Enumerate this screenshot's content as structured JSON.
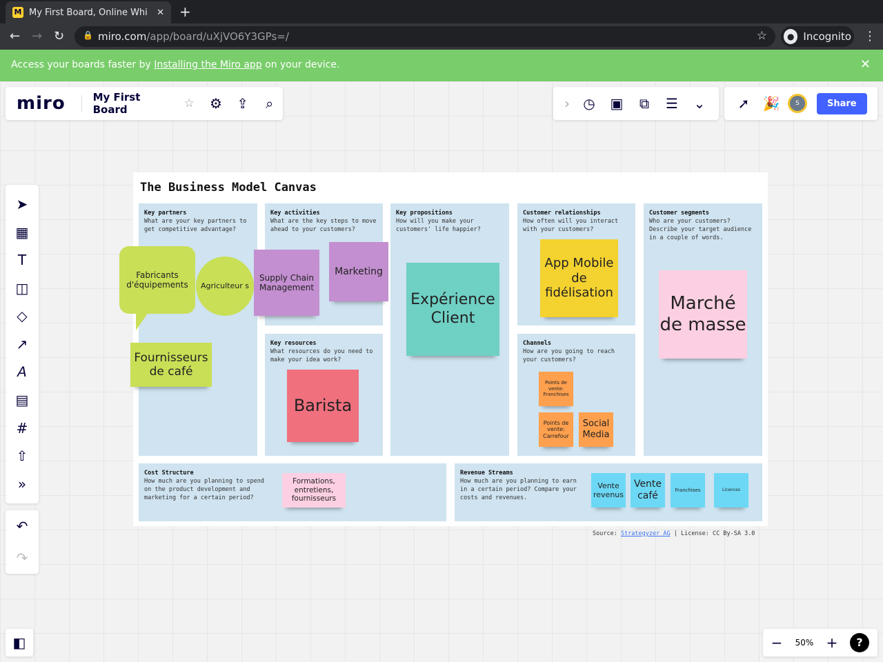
{
  "browser": {
    "tab_title": "My First Board, Online Whi",
    "url_host": "miro.com",
    "url_path": "/app/board/uXjVO6Y3GPs=/",
    "incognito": "Incognito"
  },
  "banner": {
    "pre": "Access your boards faster by ",
    "link": "Installing the Miro app",
    "post": " on your device."
  },
  "header": {
    "logo": "miro",
    "board_name": "My First Board",
    "share": "Share",
    "avatar": "S"
  },
  "zoom": {
    "level": "50%",
    "help": "?"
  },
  "canvas": {
    "title": "The Business Model Canvas",
    "cells": {
      "partners": {
        "title": "Key partners",
        "desc": "What are your key partners to get competitive advantage?"
      },
      "activities": {
        "title": "Key activities",
        "desc": "What are the key steps to move ahead to your customers?"
      },
      "resources": {
        "title": "Key resources",
        "desc": "What resources do you need to make your idea work?"
      },
      "propositions": {
        "title": "Key propositions",
        "desc": "How will you make your customers' life happier?"
      },
      "relationships": {
        "title": "Customer relationships",
        "desc": "How often will you interact with your customers?"
      },
      "channels": {
        "title": "Channels",
        "desc": "How are you going to reach your customers?"
      },
      "segments": {
        "title": "Customer segments",
        "desc": "Who are your customers? Describe your target audience in a couple of words."
      },
      "cost": {
        "title": "Cost Structure",
        "desc": "How much are you planning to spend on the product development and marketing for a certain period?"
      },
      "revenue": {
        "title": "Revenue Streams",
        "desc": "How much are you planning to earn in a certain period? Compare your costs and revenues."
      }
    },
    "stickies": {
      "fabricants": "Fabricants d'équipements",
      "agriculteurs": "Agriculteur s",
      "fournisseurs": "Fournisseurs de café",
      "supply": "Supply Chain Management",
      "marketing": "Marketing",
      "barista": "Barista",
      "experience": "Expérience Client",
      "app": "App Mobile de fidélisation",
      "pdv_franchises": "Points de vente: Franchises",
      "pdv_carrefour": "Points de vente: Carrefour",
      "social": "Social Media",
      "marche": "Marché de masse",
      "formations": "Formations, entretiens, fournisseurs",
      "vente_revenus": "Vente revenus",
      "vente_cafe": "Vente café",
      "franchises": "Franchises",
      "licences": "Licences"
    },
    "source_label": "Source: ",
    "source_link": "Strategyzer AG",
    "license": " | License: CC By-SA 3.0"
  },
  "colors": {
    "green": "#c9df56",
    "purple": "#c38fd0",
    "teal": "#6fd0c4",
    "yellow": "#f4d22f",
    "orange": "#ffa04e",
    "pink": "#fdcfe2",
    "red": "#f0707e",
    "cyan": "#6dd8f5",
    "share": "#4262ff",
    "banner": "#79cd6b"
  }
}
